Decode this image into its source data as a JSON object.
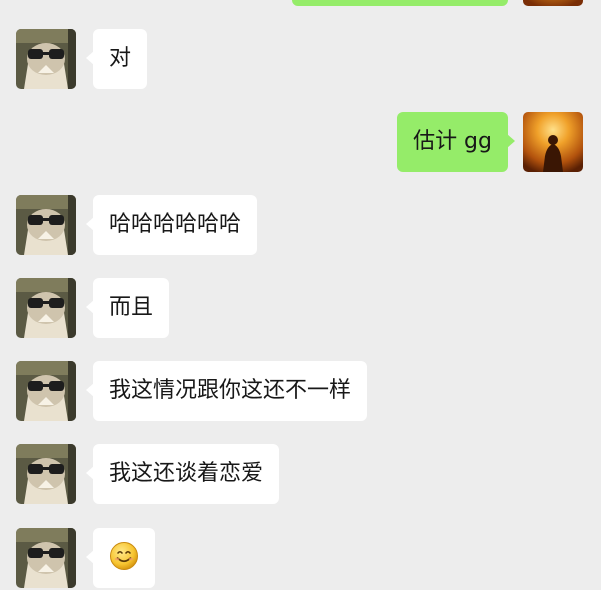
{
  "messages": [
    {
      "side": "out",
      "text": "",
      "partial": true
    },
    {
      "side": "in",
      "text": "对"
    },
    {
      "side": "out",
      "text": "估计 gg"
    },
    {
      "side": "in",
      "text": "哈哈哈哈哈哈"
    },
    {
      "side": "in",
      "text": "而且"
    },
    {
      "side": "in",
      "text": "我这情况跟你这还不一样"
    },
    {
      "side": "in",
      "text": "我这还谈着恋爱"
    },
    {
      "side": "in",
      "emoji": "smile-emoji"
    }
  ],
  "colors": {
    "background": "#ededed",
    "incoming_bubble": "#ffffff",
    "outgoing_bubble": "#95ec69",
    "text": "#181818"
  }
}
